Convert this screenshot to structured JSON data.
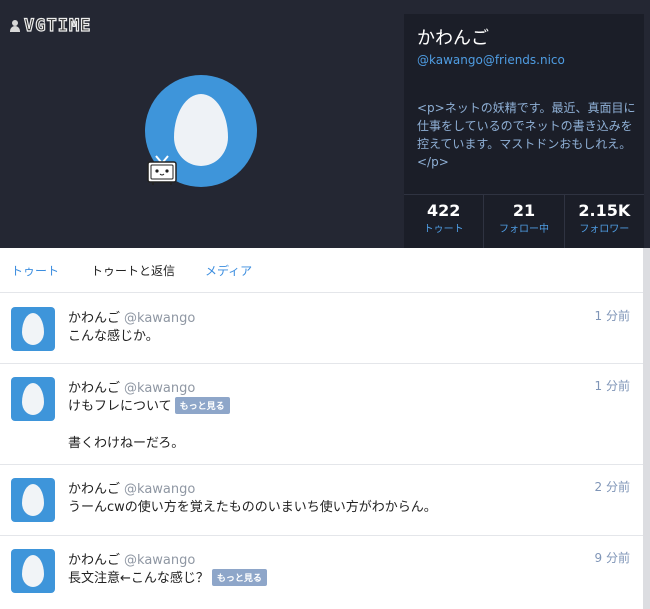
{
  "watermark": {
    "text": "VGTIME"
  },
  "profile": {
    "display_name": "かわんご",
    "handle": "@kawango@friends.nico",
    "bio": "<p>ネットの妖精です。最近、真面目に仕事をしているのでネットの書き込みを控えています。マストドンおもしれえ。</p>",
    "stats": [
      {
        "value": "422",
        "label": "トゥート"
      },
      {
        "value": "21",
        "label": "フォロー中"
      },
      {
        "value": "2.15K",
        "label": "フォロワー"
      }
    ]
  },
  "tabs": [
    {
      "label": "トゥート"
    },
    {
      "label": "トゥートと返信"
    },
    {
      "label": "メディア"
    }
  ],
  "toots": [
    {
      "author": "かわんご",
      "handle": "@kawango",
      "time": "1 分前",
      "text": "こんな感じか。"
    },
    {
      "author": "かわんご",
      "handle": "@kawango",
      "time": "1 分前",
      "text": "けもフレについて",
      "more": "もっと見る",
      "extra": "書くわけねーだろ。"
    },
    {
      "author": "かわんご",
      "handle": "@kawango",
      "time": "2 分前",
      "text": "うーんcwの使い方を覚えたもののいまいち使い方がわからん。"
    },
    {
      "author": "かわんご",
      "handle": "@kawango",
      "time": "9 分前",
      "text": "長文注意←こんな感じ？",
      "more": "もっと見る"
    }
  ],
  "colors": {
    "header_bg": "#242733",
    "card_bg": "#1b1e28",
    "accent": "#3b8ddf",
    "avatar_blue": "#3e95da"
  }
}
